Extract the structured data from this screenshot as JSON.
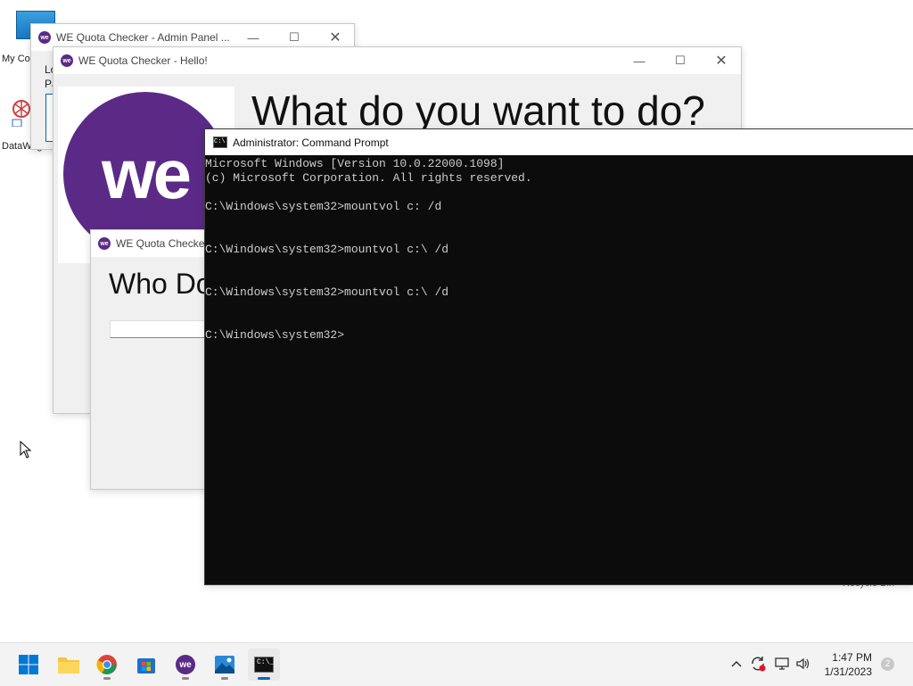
{
  "desktop": {
    "icons": [
      {
        "label": "My Co",
        "icon": "monitor-icon"
      },
      {
        "label": "DataWago",
        "icon": "datawagon-icon"
      },
      {
        "label": "Recycle Bin",
        "icon": "recycle-bin-icon"
      }
    ]
  },
  "window_admin": {
    "title": "WE Quota Checker - Admin Panel ...",
    "side_text_1": "Lo",
    "side_text_2": "Pa"
  },
  "window_hello": {
    "title": "WE Quota Checker - Hello!",
    "heading": "What do you want to do?",
    "logo_text": "we"
  },
  "window_who": {
    "title": "WE Quota Checker",
    "heading": "Who Do"
  },
  "cmd": {
    "title": "Administrator:  Command Prompt",
    "lines": [
      "Microsoft Windows [Version 10.0.22000.1098]",
      "(c) Microsoft Corporation. All rights reserved.",
      "",
      "C:\\Windows\\system32>mountvol c: /d",
      "",
      "",
      "C:\\Windows\\system32>mountvol c:\\ /d",
      "",
      "",
      "C:\\Windows\\system32>mountvol c:\\ /d",
      "",
      "",
      "C:\\Windows\\system32>"
    ]
  },
  "taskbar": {
    "apps": [
      {
        "name": "start",
        "icon": "windows-start-icon"
      },
      {
        "name": "file-explorer",
        "icon": "folder-icon"
      },
      {
        "name": "chrome",
        "icon": "chrome-icon"
      },
      {
        "name": "store",
        "icon": "store-icon"
      },
      {
        "name": "we-quota",
        "icon": "we-app-icon",
        "label": "we"
      },
      {
        "name": "photos",
        "icon": "photos-icon"
      },
      {
        "name": "cmd",
        "icon": "cmd-icon"
      }
    ],
    "time": "1:47 PM",
    "date": "1/31/2023",
    "notification_count": "2"
  },
  "colors": {
    "we_purple": "#5b2a86",
    "cmd_bg": "#0c0c0c",
    "cmd_text": "#cccccc"
  }
}
